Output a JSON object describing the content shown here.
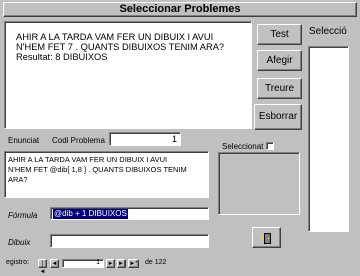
{
  "window": {
    "title": "Seleccionar Problemes"
  },
  "problem_display": {
    "text": "AHIR A LA TARDA VAM FER UN DIBUIX I AVUI\nN'HEM FET 7 . QUANTS DIBUIXOS TENIM ARA?\nResultat: 8 DIBUIXOS"
  },
  "buttons": {
    "test": "Test",
    "add": "Afegir",
    "remove": "Treure",
    "delete": "Esborrar"
  },
  "selection_panel": {
    "label": "Selecció"
  },
  "enunciat": {
    "label": "Enunciat"
  },
  "codi_problema": {
    "label": "Codi Problema",
    "value": "1"
  },
  "enunciat_text": {
    "value": "AHIR A LA TARDA VAM FER UN DIBUIX I AVUI\nN'HEM FET @dib[ 1,8 ] . QUANTS DIBUIXOS TENIM\nARA?"
  },
  "seleccionat": {
    "label": "Seleccionat"
  },
  "formula": {
    "label": "Fórmula",
    "value": "@dib + 1 DIBUIXOS"
  },
  "dibuix": {
    "label": "Dibuix",
    "value": ""
  },
  "record_nav": {
    "label": "egistro:",
    "first": "|◄",
    "prev": "◄",
    "current": "1",
    "next": "►",
    "last": "►|",
    "new": "►*",
    "of_text": "de 122"
  },
  "colors": {
    "background": "#c0c0c0",
    "selection": "#000080"
  }
}
